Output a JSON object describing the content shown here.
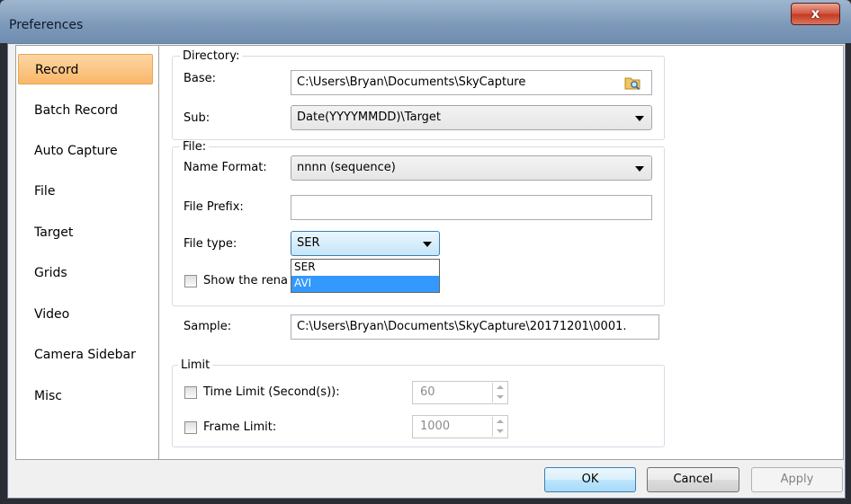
{
  "window": {
    "title": "Preferences",
    "close_label": "x"
  },
  "sidebar": {
    "items": [
      {
        "label": "Record",
        "selected": true
      },
      {
        "label": "Batch Record"
      },
      {
        "label": "Auto Capture"
      },
      {
        "label": "File"
      },
      {
        "label": "Target"
      },
      {
        "label": "Grids"
      },
      {
        "label": "Video"
      },
      {
        "label": "Camera Sidebar"
      },
      {
        "label": "Misc"
      }
    ]
  },
  "directory": {
    "legend": "Directory:",
    "base_label": "Base:",
    "base_value": "C:\\Users\\Bryan\\Documents\\SkyCapture",
    "sub_label": "Sub:",
    "sub_value": "Date(YYYYMMDD)\\Target"
  },
  "file": {
    "legend": "File:",
    "name_format_label": "Name Format:",
    "name_format_value": "nnnn (sequence)",
    "prefix_label": "File Prefix:",
    "prefix_value": "",
    "type_label": "File type:",
    "type_value": "SER",
    "type_options": [
      "SER",
      "AVI"
    ],
    "highlighted_option": "AVI",
    "show_rename_label": "Show the rena"
  },
  "sample": {
    "label": "Sample:",
    "value": "C:\\Users\\Bryan\\Documents\\SkyCapture\\20171201\\0001."
  },
  "limit": {
    "legend": "Limit",
    "time_label": "Time Limit (Second(s)):",
    "time_value": "60",
    "frame_label": "Frame Limit:",
    "frame_value": "1000"
  },
  "buttons": {
    "ok": "OK",
    "cancel": "Cancel",
    "apply": "Apply"
  },
  "colors": {
    "selected_item": "#f9b769",
    "highlight": "#3399ff",
    "close_button": "#c43b24"
  }
}
